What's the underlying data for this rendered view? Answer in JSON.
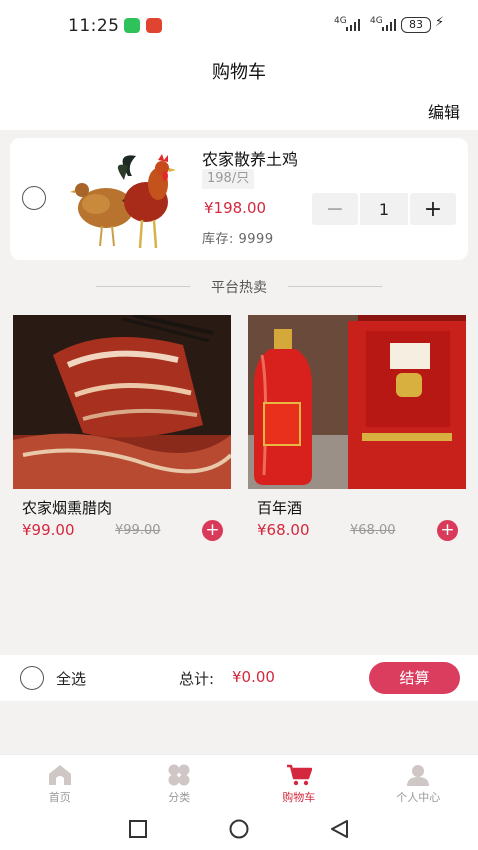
{
  "status_bar": {
    "time": "11:25",
    "signal_1": "4G",
    "signal_2": "4G",
    "battery": "83"
  },
  "header": {
    "title": "购物车",
    "edit_label": "编辑"
  },
  "cart_items": [
    {
      "name": "农家散养土鸡",
      "spec": "198/只",
      "price": "¥198.00",
      "stock": "库存:  9999",
      "quantity": "1",
      "image": "rooster-and-hen-photo"
    }
  ],
  "stepper": {
    "minus_symbol": "−",
    "plus_symbol": "+"
  },
  "hot_section": {
    "title": "平台热卖"
  },
  "products": [
    {
      "name": "农家烟熏腊肉",
      "price": "¥99.00",
      "old_price": "¥99.00",
      "image": "smoked-bacon-photo"
    },
    {
      "name": "百年酒",
      "price": "¥68.00",
      "old_price": "¥68.00",
      "image": "red-liquor-bottle-photo"
    }
  ],
  "add_symbol": "+",
  "checkout": {
    "select_all_label": "全选",
    "total_label": "总计:",
    "total_value": "¥0.00",
    "button_label": "结算"
  },
  "tabs": [
    {
      "label": "首页",
      "icon": "home-icon",
      "active": false
    },
    {
      "label": "分类",
      "icon": "category-icon",
      "active": false
    },
    {
      "label": "购物车",
      "icon": "cart-icon",
      "active": true
    },
    {
      "label": "个人中心",
      "icon": "profile-icon",
      "active": false
    }
  ],
  "colors": {
    "accent": "#d4283e",
    "button": "#db3d5f",
    "background": "#f4f2f1",
    "inactive_tab": "#999999"
  }
}
